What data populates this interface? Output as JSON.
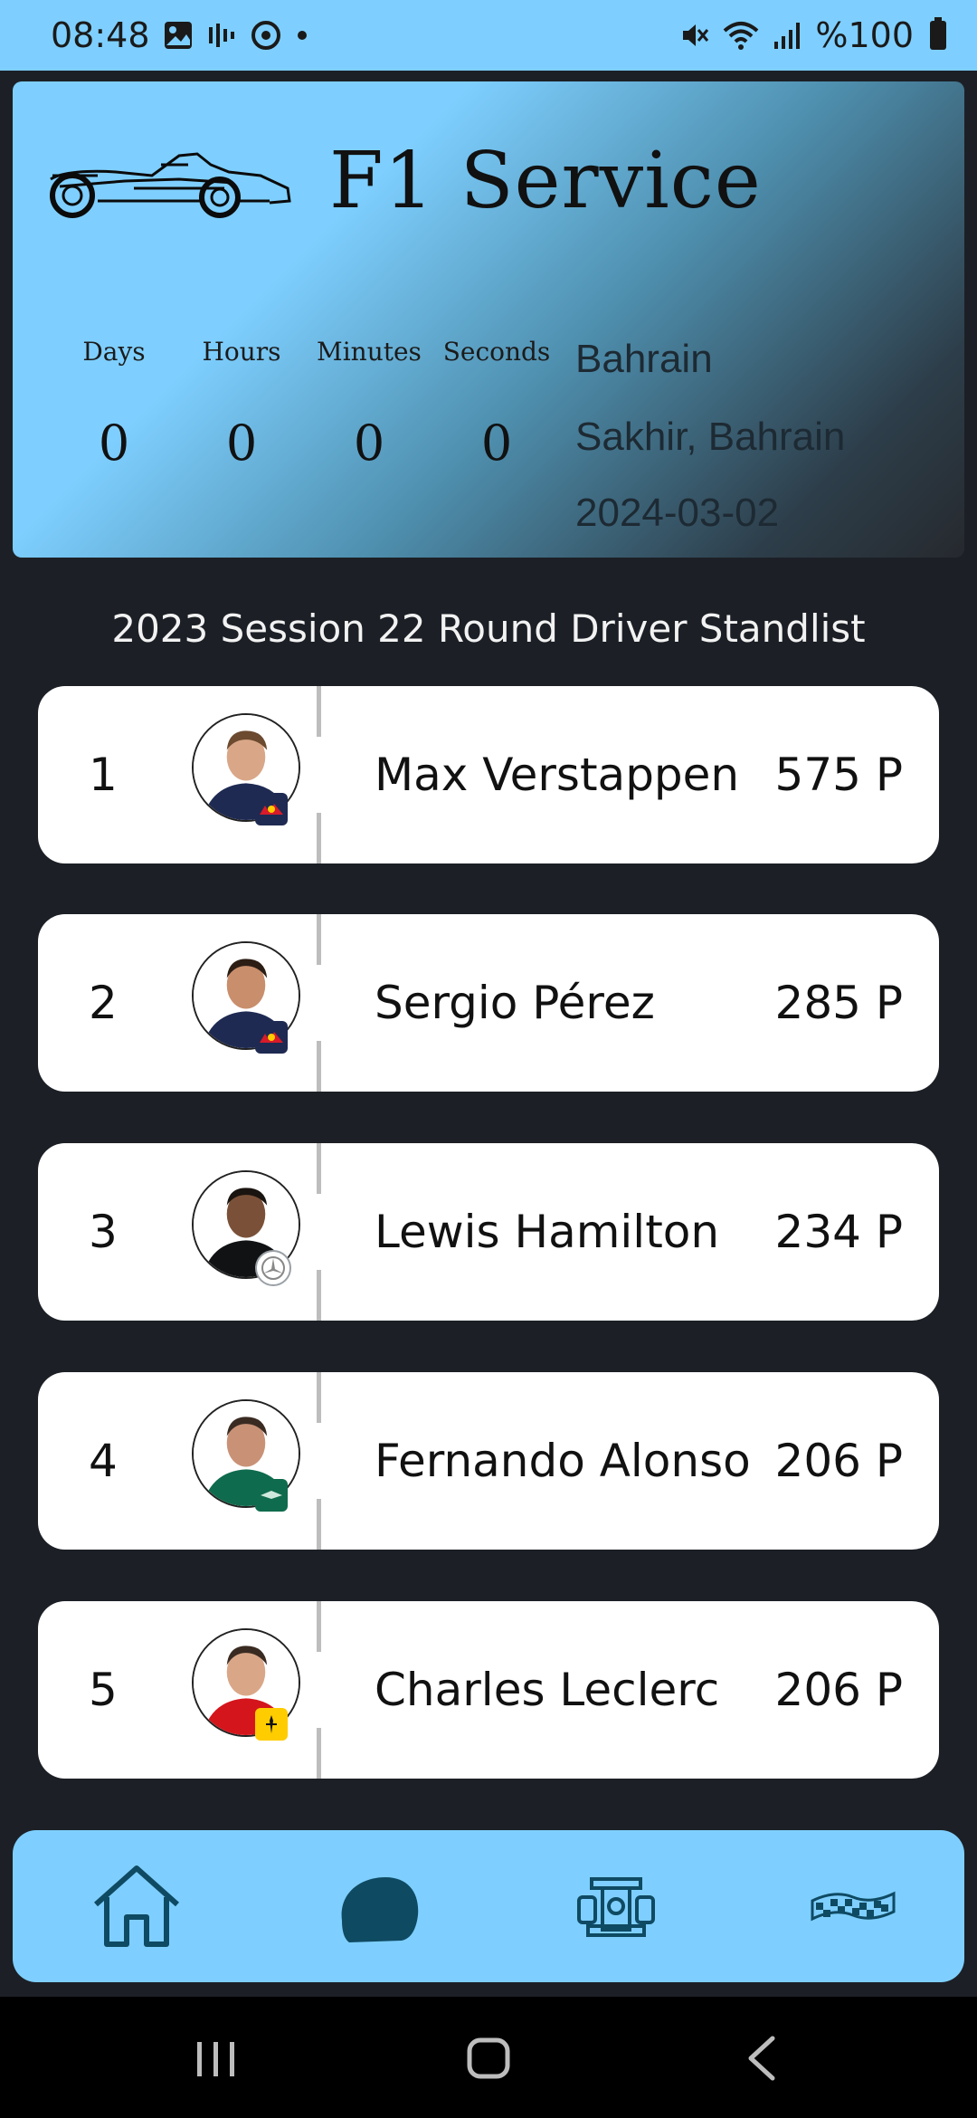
{
  "status_bar": {
    "time": "08:48",
    "battery_text": "%100",
    "left_icons": [
      "gallery-icon",
      "voice-icon",
      "sync-icon",
      "dot-icon"
    ],
    "right_icons": [
      "mute-icon",
      "wifi-icon",
      "signal-icon",
      "battery-icon"
    ]
  },
  "header": {
    "title": "F1 Service",
    "countdown": {
      "labels": [
        "Days",
        "Hours",
        "Minutes",
        "Seconds"
      ],
      "values": [
        "0",
        "0",
        "0",
        "0"
      ]
    },
    "race": {
      "name": "Bahrain",
      "location": "Sakhir, Bahrain",
      "date": "2024-03-02"
    }
  },
  "standings": {
    "title": "2023 Session 22 Round Driver Standlist",
    "drivers": [
      {
        "pos": "1",
        "name": "Max Verstappen",
        "points": "575 P",
        "team_color": "#d71b2a"
      },
      {
        "pos": "2",
        "name": "Sergio Pérez",
        "points": "285 P",
        "team_color": "#d71b2a"
      },
      {
        "pos": "3",
        "name": "Lewis Hamilton",
        "points": "234 P",
        "team_color": "#9aa0a6"
      },
      {
        "pos": "4",
        "name": "Fernando Alonso",
        "points": "206 P",
        "team_color": "#0f6b4d"
      },
      {
        "pos": "5",
        "name": "Charles Leclerc",
        "points": "206 P",
        "team_color": "#ffcc00"
      }
    ]
  },
  "bottom_nav": {
    "items": [
      "home-icon",
      "helmet-icon",
      "f1-car-icon",
      "checkered-flag-icon"
    ],
    "active": "helmet-icon",
    "accent": "#7ecfff",
    "icon_color": "#0f4a63"
  },
  "system_nav": [
    "recent-apps-button",
    "home-button",
    "back-button"
  ]
}
